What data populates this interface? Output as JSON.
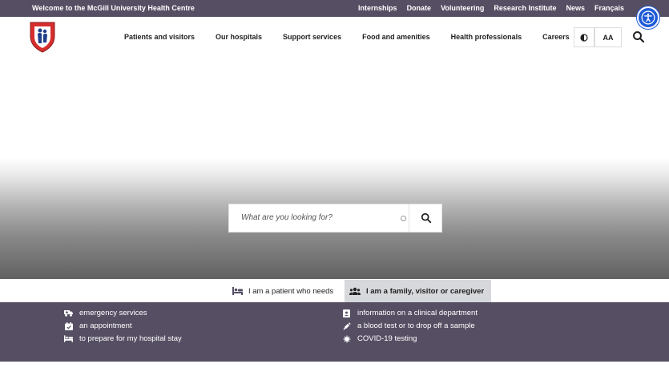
{
  "topbar": {
    "welcome": "Welcome to the McGill University Health Centre",
    "links": [
      "Internships",
      "Donate",
      "Volunteering",
      "Research Institute",
      "News",
      "Français"
    ]
  },
  "nav": {
    "items": [
      "Patients and visitors",
      "Our hospitals",
      "Support services",
      "Food and amenities",
      "Health professionals",
      "Careers"
    ],
    "text_size_label": "AA"
  },
  "search": {
    "placeholder": "What are you looking for?"
  },
  "tabs": {
    "patient": "I am a patient who needs",
    "family": "I am a family, visitor or caregiver"
  },
  "services": {
    "left": [
      "emergency services",
      "an appointment",
      "to prepare for my hospital stay"
    ],
    "right": [
      "information on a clinical department",
      "a blood test or to drop off a sample",
      "COVID-19 testing"
    ]
  },
  "colors": {
    "brand_purple": "#564f64",
    "accessibility_blue": "#1f5bd8",
    "logo_red": "#d62e2e"
  }
}
